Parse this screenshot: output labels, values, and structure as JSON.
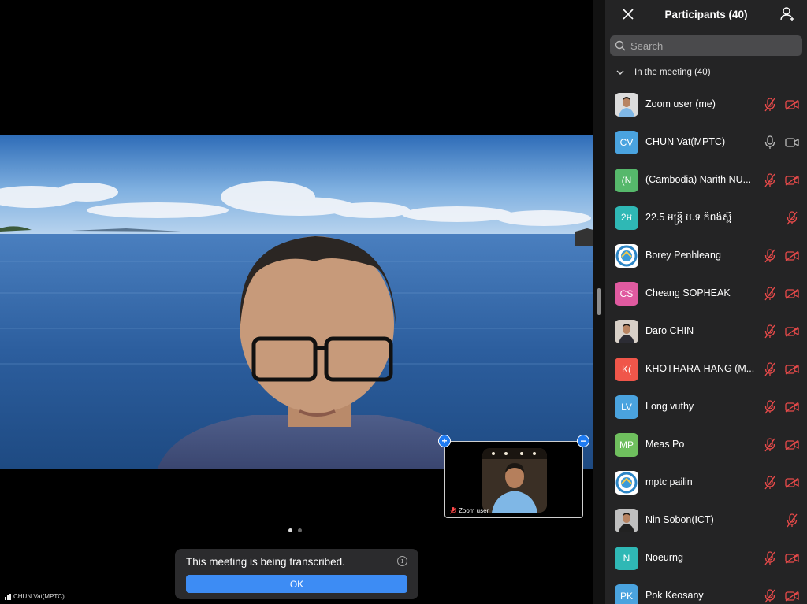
{
  "main": {
    "speaker_label": "CHUN Vat(MPTC)",
    "pip": {
      "label": "Zoom user",
      "add_icon": "plus-icon",
      "minimize_icon": "minus-icon"
    },
    "page_dots": {
      "count": 2,
      "active": 0
    },
    "toast": {
      "message": "This meeting is being transcribed.",
      "ok_label": "OK",
      "info_icon": "info-icon"
    }
  },
  "panel": {
    "title": "Participants (40)",
    "search_placeholder": "Search",
    "section_label": "In the meeting (40)",
    "participants": [
      {
        "name": "Zoom user (me)",
        "initials": "",
        "avatar_type": "photo-person-blue",
        "color": "#dcdcdc",
        "mic": "muted",
        "cam": "off"
      },
      {
        "name": "CHUN Vat(MPTC)",
        "initials": "CV",
        "avatar_type": "initials",
        "color": "#4aa3df",
        "mic": "on",
        "cam": "on"
      },
      {
        "name": "(Cambodia) Narith NU...",
        "initials": "(N",
        "avatar_type": "initials",
        "color": "#56b86b",
        "mic": "muted",
        "cam": "off"
      },
      {
        "name": "22.5 មន្ត្រី ប.ទ កំពង់ស្ពឺ",
        "initials": "2ម",
        "avatar_type": "initials",
        "color": "#2fb8b5",
        "mic": "muted",
        "cam": "none"
      },
      {
        "name": "Borey Penhleang",
        "initials": "",
        "avatar_type": "photo-logo",
        "color": "#2d86c6",
        "mic": "muted",
        "cam": "off"
      },
      {
        "name": "Cheang SOPHEAK",
        "initials": "CS",
        "avatar_type": "initials",
        "color": "#e05aa0",
        "mic": "muted",
        "cam": "off"
      },
      {
        "name": "Daro CHIN",
        "initials": "",
        "avatar_type": "photo-person-suit",
        "color": "#d8d0c8",
        "mic": "muted",
        "cam": "off"
      },
      {
        "name": "KHOTHARA-HANG (M...",
        "initials": "K(",
        "avatar_type": "initials",
        "color": "#f0564a",
        "mic": "muted",
        "cam": "off"
      },
      {
        "name": "Long vuthy",
        "initials": "LV",
        "avatar_type": "initials",
        "color": "#4aa3df",
        "mic": "muted",
        "cam": "off"
      },
      {
        "name": "Meas Po",
        "initials": "MP",
        "avatar_type": "initials",
        "color": "#6fbf5e",
        "mic": "muted",
        "cam": "off"
      },
      {
        "name": "mptc pailin",
        "initials": "",
        "avatar_type": "photo-logo",
        "color": "#2d86c6",
        "mic": "muted",
        "cam": "off"
      },
      {
        "name": "Nin Sobon(ICT)",
        "initials": "",
        "avatar_type": "photo-person-dark",
        "color": "#bfbfbf",
        "mic": "muted",
        "cam": "none"
      },
      {
        "name": "Noeurng",
        "initials": "N",
        "avatar_type": "initials",
        "color": "#2fb8b5",
        "mic": "muted",
        "cam": "off"
      },
      {
        "name": "Pok Keosany",
        "initials": "PK",
        "avatar_type": "initials",
        "color": "#4aa3df",
        "mic": "muted",
        "cam": "off"
      }
    ]
  }
}
